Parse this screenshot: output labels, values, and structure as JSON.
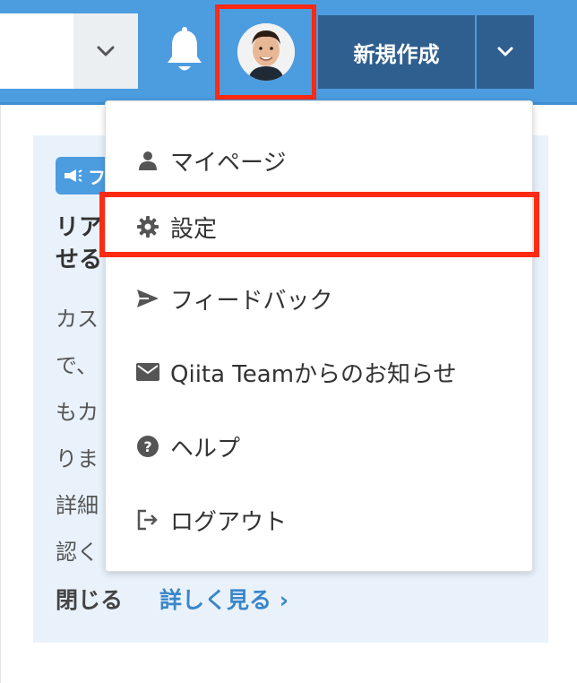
{
  "header": {
    "new_post_label": "新規作成"
  },
  "notice": {
    "badge_text": "フ",
    "title": "リア\nせる",
    "body": "カス\nで、\nもカ\nりま\n詳細\n認く",
    "close_label": "閉じる",
    "more_label": "詳しく見る ›"
  },
  "menu": {
    "items": [
      {
        "label": "マイページ",
        "icon": "person-icon"
      },
      {
        "label": "設定",
        "icon": "gear-icon"
      },
      {
        "label": "フィードバック",
        "icon": "send-icon"
      },
      {
        "label": "Qiita Teamからのお知らせ",
        "icon": "mail-icon"
      },
      {
        "label": "ヘルプ",
        "icon": "help-icon"
      },
      {
        "label": "ログアウト",
        "icon": "logout-icon"
      }
    ]
  },
  "colors": {
    "header_bg": "#4c9ce0",
    "primary_button": "#2f5f8f",
    "highlight_border": "#ff2a12",
    "link": "#3a86c8"
  }
}
